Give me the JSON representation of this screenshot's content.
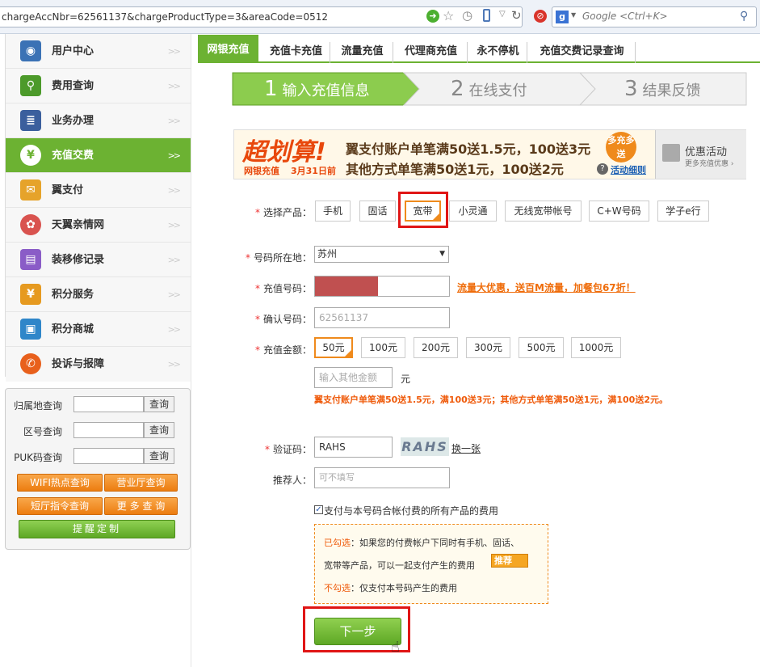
{
  "browser": {
    "url": "chargeAccNbr=62561137&chargeProductType=3&areaCode=0512",
    "search_placeholder": "Google <Ctrl+K>"
  },
  "sidebar": {
    "items": [
      {
        "label": "用户中心",
        "icon": "user-icon",
        "color": "#3b72b5"
      },
      {
        "label": "费用查询",
        "icon": "magnifier-icon",
        "color": "#4c9a2a"
      },
      {
        "label": "业务办理",
        "icon": "document-icon",
        "color": "#3b5f9d"
      },
      {
        "label": "充值交费",
        "icon": "yuan-coin-icon",
        "color": "#6cb232"
      },
      {
        "label": "翼支付",
        "icon": "wallet-icon",
        "color": "#e6a32a"
      },
      {
        "label": "天翼亲情网",
        "icon": "family-network-icon",
        "color": "#d9534f"
      },
      {
        "label": "装移修记录",
        "icon": "record-book-icon",
        "color": "#8a5cc7"
      },
      {
        "label": "积分服务",
        "icon": "points-bag-icon",
        "color": "#e69a20"
      },
      {
        "label": "积分商城",
        "icon": "gift-shop-icon",
        "color": "#2f86c9"
      },
      {
        "label": "投诉与报障",
        "icon": "phone-handset-icon",
        "color": "#e8601c"
      }
    ],
    "arrow": ">>",
    "active_index": 3
  },
  "quickquery": {
    "rows": [
      {
        "label": "归属地查询",
        "button": "查询"
      },
      {
        "label": "区号查询",
        "button": "查询"
      },
      {
        "label": "PUK码查询",
        "button": "查询"
      }
    ],
    "buttons": [
      "WIFI热点查询",
      "营业厅查询",
      "短厅指令查询",
      "更 多 查 询"
    ],
    "remind": "提醒定制"
  },
  "tabs": [
    "网银充值",
    "充值卡充值",
    "流量充值",
    "代理商充值",
    "永不停机",
    "充值交费记录查询"
  ],
  "steps": [
    {
      "num": "1",
      "label": "输入充值信息"
    },
    {
      "num": "2",
      "label": "在线支付"
    },
    {
      "num": "3",
      "label": "结果反馈"
    }
  ],
  "banner": {
    "big": "超划算!",
    "sub1": "网银充值",
    "sub2": "3月31日前",
    "line1": "翼支付账户单笔满50送1.5元，100送3元",
    "line2": "其他方式单笔满50送1元，100送2元",
    "badge": "多充多送",
    "rules": "活动细则",
    "promo_title": "优惠活动",
    "promo_sub": "更多充值优惠 ›"
  },
  "form": {
    "product_label": "选择产品：",
    "products": [
      "手机",
      "固话",
      "宽带",
      "小灵通",
      "无线宽带帐号",
      "C+W号码",
      "学子e行"
    ],
    "selected_product": "宽带",
    "region_label": "号码所在地：",
    "region_value": "苏州",
    "number_label": "充值号码：",
    "number_promo": "流量大优惠，送百M流量，加餐包67折！",
    "confirm_label": "确认号码：",
    "confirm_value": "62561137",
    "amount_label": "充值金额：",
    "amounts": [
      "50元",
      "100元",
      "200元",
      "300元",
      "500元",
      "1000元"
    ],
    "selected_amount": "50元",
    "other_amount_placeholder": "输入其他金额",
    "unit": "元",
    "amount_promo": "翼支付账户单笔满50送1.5元，满100送3元；其他方式单笔满50送1元，满100送2元。",
    "captcha_label": "验证码：",
    "captcha_value": "RAHS",
    "captcha_image_text": "RAHS",
    "captcha_refresh": "换一张",
    "referrer_label": "推荐人：",
    "referrer_placeholder": "可不填写",
    "pay_all_label": "支付与本号码合帐付费的所有产品的费用",
    "pay_all_checked": true,
    "info_checked_title": "已勾选",
    "info_checked_text": "：如果您的付费帐户下同时有手机、固话、",
    "info_checked_text2": "宽带等产品，可以一起支付产生的费用",
    "info_recommend": "推荐",
    "info_unchecked_title": "不勾选",
    "info_unchecked_text": "：仅支付本号码产生的费用",
    "next_button": "下一步"
  },
  "colors": {
    "green": "#6cb232",
    "orange": "#ef8a1c",
    "red_highlight": "#e01515"
  }
}
